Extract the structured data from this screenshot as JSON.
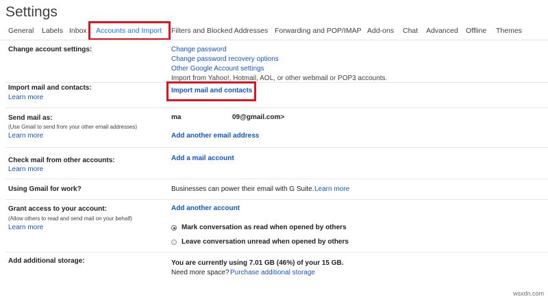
{
  "page": {
    "title": "Settings",
    "watermark": "wsxdn.com"
  },
  "tabs": [
    {
      "label": "General"
    },
    {
      "label": "Labels"
    },
    {
      "label": "Inbox"
    },
    {
      "label": "Accounts and Import",
      "active": true
    },
    {
      "label": "Filters and Blocked Addresses"
    },
    {
      "label": "Forwarding and POP/IMAP"
    },
    {
      "label": "Add-ons"
    },
    {
      "label": "Chat"
    },
    {
      "label": "Advanced"
    },
    {
      "label": "Offline"
    },
    {
      "label": "Themes"
    }
  ],
  "sections": {
    "change_account": {
      "label": "Change account settings:",
      "links": [
        "Change password",
        "Change password recovery options",
        "Other Google Account settings"
      ]
    },
    "import": {
      "label": "Import mail and contacts:",
      "learn_more": "Learn more",
      "description": "Import from Yahoo!, Hotmail, AOL, or other webmail or POP3 accounts.",
      "action": "Import mail and contacts"
    },
    "send_mail": {
      "label": "Send mail as:",
      "note": "(Use Gmail to send from your other email addresses)",
      "learn_more": "Learn more",
      "name": "ma",
      "email": "09@gmail.com>",
      "action": "Add another email address"
    },
    "check_mail": {
      "label": "Check mail from other accounts:",
      "learn_more": "Learn more",
      "action": "Add a mail account"
    },
    "work": {
      "label": "Using Gmail for work?",
      "text": "Businesses can power their email with G Suite.",
      "learn_more": "Learn more"
    },
    "grant": {
      "label": "Grant access to your account:",
      "note": "(Allow others to read and send mail on your behalf)",
      "learn_more": "Learn more",
      "action": "Add another account",
      "options": [
        {
          "label": "Mark conversation as read when opened by others",
          "checked": true
        },
        {
          "label": "Leave conversation unread when opened by others",
          "checked": false
        }
      ]
    },
    "storage": {
      "label": "Add additional storage:",
      "usage": "You are currently using 7.01 GB (46%) of your 15 GB.",
      "need_more": "Need more space?",
      "purchase": "Purchase additional storage"
    }
  },
  "colors": {
    "link": "#1155cc",
    "active_tab": "#1a73e8",
    "highlight": "#e3121d"
  }
}
